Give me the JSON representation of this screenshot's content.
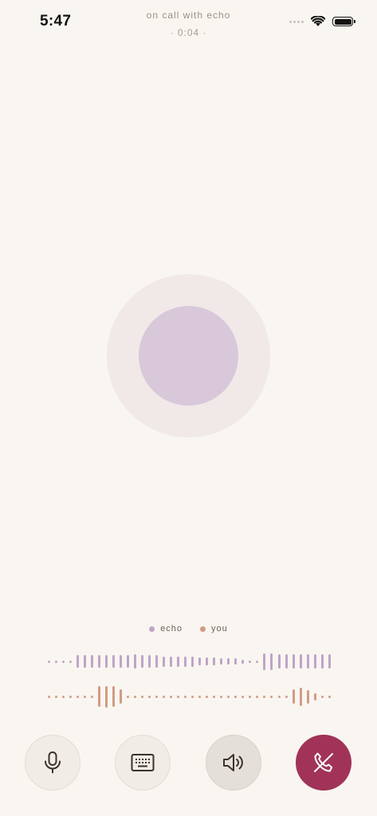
{
  "status_bar": {
    "time": "5:47",
    "call_title": "on call with echo",
    "call_timer": "· 0:04 ·"
  },
  "legend": {
    "echo_label": "echo",
    "you_label": "you"
  },
  "colors": {
    "background": "#f9f6f1",
    "echo": "#c0a4c8",
    "you": "#d39b85",
    "end_call": "#a13358",
    "avatar_inner": "#d8c8da",
    "avatar_outer": "#f0e9e8"
  },
  "waveforms": {
    "echo_levels": [
      0.1,
      0.1,
      0.1,
      0.1,
      0.6,
      0.6,
      0.6,
      0.6,
      0.6,
      0.6,
      0.6,
      0.6,
      0.7,
      0.6,
      0.6,
      0.6,
      0.5,
      0.5,
      0.5,
      0.5,
      0.5,
      0.4,
      0.4,
      0.4,
      0.3,
      0.3,
      0.3,
      0.2,
      0.1,
      0.1,
      0.8,
      0.8,
      0.7,
      0.7,
      0.7,
      0.7,
      0.7,
      0.7,
      0.7,
      0.7
    ],
    "you_levels": [
      0.1,
      0.1,
      0.1,
      0.1,
      0.1,
      0.1,
      0.1,
      0.85,
      0.9,
      0.85,
      0.6,
      0.1,
      0.1,
      0.1,
      0.1,
      0.1,
      0.1,
      0.1,
      0.1,
      0.1,
      0.1,
      0.1,
      0.1,
      0.1,
      0.1,
      0.1,
      0.1,
      0.1,
      0.1,
      0.1,
      0.1,
      0.1,
      0.1,
      0.1,
      0.6,
      0.75,
      0.55,
      0.3,
      0.1,
      0.1
    ]
  },
  "controls": {
    "mute_icon": "microphone-icon",
    "keypad_icon": "keyboard-icon",
    "speaker_icon": "speaker-icon",
    "speaker_active": true,
    "end_icon": "phone-hangup-icon"
  }
}
